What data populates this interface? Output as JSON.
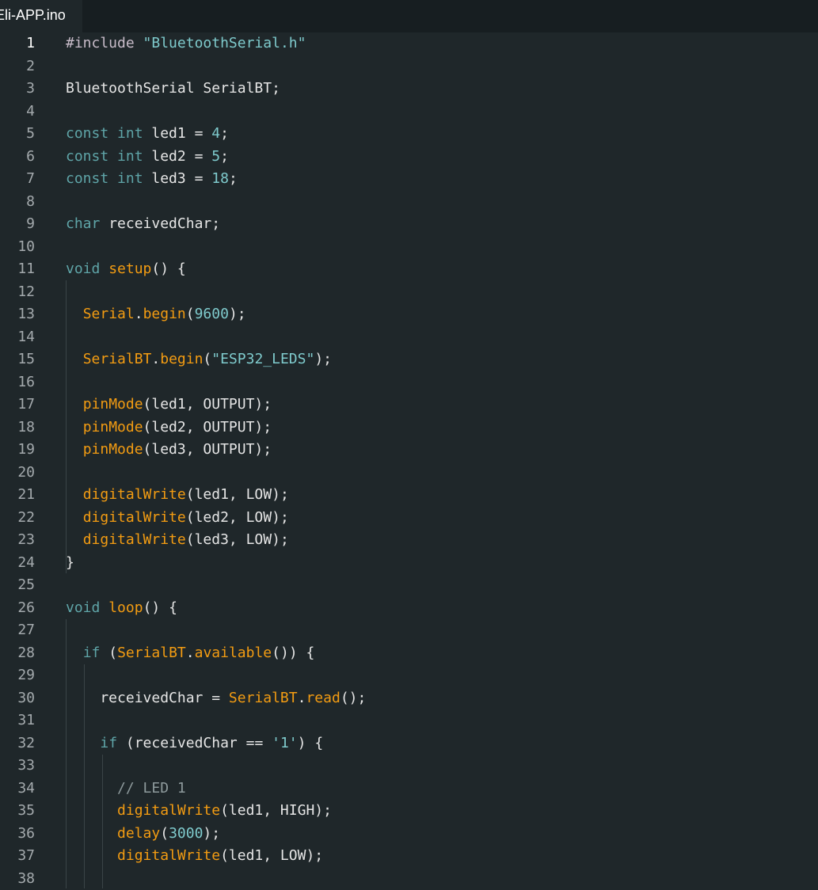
{
  "tab": {
    "label": "Eli-APP.ino"
  },
  "editor": {
    "active_line": 1,
    "lines": [
      {
        "n": "1",
        "tokens": [
          {
            "t": "#include ",
            "c": "pp"
          },
          {
            "t": "\"BluetoothSerial.h\"",
            "c": "str"
          }
        ]
      },
      {
        "n": "2",
        "tokens": []
      },
      {
        "n": "3",
        "tokens": [
          {
            "t": "BluetoothSerial SerialBT;",
            "c": "tx"
          }
        ]
      },
      {
        "n": "4",
        "tokens": []
      },
      {
        "n": "5",
        "tokens": [
          {
            "t": "const",
            "c": "kw"
          },
          {
            "t": " ",
            "c": "tx"
          },
          {
            "t": "int",
            "c": "kw"
          },
          {
            "t": " led1 = ",
            "c": "tx"
          },
          {
            "t": "4",
            "c": "num"
          },
          {
            "t": ";",
            "c": "tx"
          }
        ]
      },
      {
        "n": "6",
        "tokens": [
          {
            "t": "const",
            "c": "kw"
          },
          {
            "t": " ",
            "c": "tx"
          },
          {
            "t": "int",
            "c": "kw"
          },
          {
            "t": " led2 = ",
            "c": "tx"
          },
          {
            "t": "5",
            "c": "num"
          },
          {
            "t": ";",
            "c": "tx"
          }
        ]
      },
      {
        "n": "7",
        "tokens": [
          {
            "t": "const",
            "c": "kw"
          },
          {
            "t": " ",
            "c": "tx"
          },
          {
            "t": "int",
            "c": "kw"
          },
          {
            "t": " led3 = ",
            "c": "tx"
          },
          {
            "t": "18",
            "c": "num"
          },
          {
            "t": ";",
            "c": "tx"
          }
        ]
      },
      {
        "n": "8",
        "tokens": []
      },
      {
        "n": "9",
        "tokens": [
          {
            "t": "char",
            "c": "kw"
          },
          {
            "t": " receivedChar;",
            "c": "tx"
          }
        ]
      },
      {
        "n": "10",
        "tokens": []
      },
      {
        "n": "11",
        "tokens": [
          {
            "t": "void",
            "c": "kw"
          },
          {
            "t": " ",
            "c": "tx"
          },
          {
            "t": "setup",
            "c": "fn"
          },
          {
            "t": "() {",
            "c": "tx"
          }
        ]
      },
      {
        "n": "12",
        "tokens": []
      },
      {
        "n": "13",
        "tokens": [
          {
            "t": "  ",
            "c": "tx"
          },
          {
            "t": "Serial",
            "c": "fn"
          },
          {
            "t": ".",
            "c": "tx"
          },
          {
            "t": "begin",
            "c": "fn"
          },
          {
            "t": "(",
            "c": "tx"
          },
          {
            "t": "9600",
            "c": "num"
          },
          {
            "t": ");",
            "c": "tx"
          }
        ]
      },
      {
        "n": "14",
        "tokens": []
      },
      {
        "n": "15",
        "tokens": [
          {
            "t": "  ",
            "c": "tx"
          },
          {
            "t": "SerialBT",
            "c": "fn"
          },
          {
            "t": ".",
            "c": "tx"
          },
          {
            "t": "begin",
            "c": "fn"
          },
          {
            "t": "(",
            "c": "tx"
          },
          {
            "t": "\"ESP32_LEDS\"",
            "c": "str"
          },
          {
            "t": ");",
            "c": "tx"
          }
        ]
      },
      {
        "n": "16",
        "tokens": []
      },
      {
        "n": "17",
        "tokens": [
          {
            "t": "  ",
            "c": "tx"
          },
          {
            "t": "pinMode",
            "c": "fn"
          },
          {
            "t": "(led1, OUTPUT);",
            "c": "tx"
          }
        ]
      },
      {
        "n": "18",
        "tokens": [
          {
            "t": "  ",
            "c": "tx"
          },
          {
            "t": "pinMode",
            "c": "fn"
          },
          {
            "t": "(led2, OUTPUT);",
            "c": "tx"
          }
        ]
      },
      {
        "n": "19",
        "tokens": [
          {
            "t": "  ",
            "c": "tx"
          },
          {
            "t": "pinMode",
            "c": "fn"
          },
          {
            "t": "(led3, OUTPUT);",
            "c": "tx"
          }
        ]
      },
      {
        "n": "20",
        "tokens": []
      },
      {
        "n": "21",
        "tokens": [
          {
            "t": "  ",
            "c": "tx"
          },
          {
            "t": "digitalWrite",
            "c": "fn"
          },
          {
            "t": "(led1, LOW);",
            "c": "tx"
          }
        ]
      },
      {
        "n": "22",
        "tokens": [
          {
            "t": "  ",
            "c": "tx"
          },
          {
            "t": "digitalWrite",
            "c": "fn"
          },
          {
            "t": "(led2, LOW);",
            "c": "tx"
          }
        ]
      },
      {
        "n": "23",
        "tokens": [
          {
            "t": "  ",
            "c": "tx"
          },
          {
            "t": "digitalWrite",
            "c": "fn"
          },
          {
            "t": "(led3, LOW);",
            "c": "tx"
          }
        ]
      },
      {
        "n": "24",
        "tokens": [
          {
            "t": "}",
            "c": "tx"
          }
        ]
      },
      {
        "n": "25",
        "tokens": []
      },
      {
        "n": "26",
        "tokens": [
          {
            "t": "void",
            "c": "kw"
          },
          {
            "t": " ",
            "c": "tx"
          },
          {
            "t": "loop",
            "c": "fn"
          },
          {
            "t": "() {",
            "c": "tx"
          }
        ]
      },
      {
        "n": "27",
        "tokens": []
      },
      {
        "n": "28",
        "tokens": [
          {
            "t": "  ",
            "c": "tx"
          },
          {
            "t": "if",
            "c": "kw"
          },
          {
            "t": " (",
            "c": "tx"
          },
          {
            "t": "SerialBT",
            "c": "fn"
          },
          {
            "t": ".",
            "c": "tx"
          },
          {
            "t": "available",
            "c": "fn"
          },
          {
            "t": "()) {",
            "c": "tx"
          }
        ]
      },
      {
        "n": "29",
        "tokens": []
      },
      {
        "n": "30",
        "tokens": [
          {
            "t": "    receivedChar = ",
            "c": "tx"
          },
          {
            "t": "SerialBT",
            "c": "fn"
          },
          {
            "t": ".",
            "c": "tx"
          },
          {
            "t": "read",
            "c": "fn"
          },
          {
            "t": "();",
            "c": "tx"
          }
        ]
      },
      {
        "n": "31",
        "tokens": []
      },
      {
        "n": "32",
        "tokens": [
          {
            "t": "    ",
            "c": "tx"
          },
          {
            "t": "if",
            "c": "kw"
          },
          {
            "t": " (receivedChar == ",
            "c": "tx"
          },
          {
            "t": "'1'",
            "c": "str"
          },
          {
            "t": ") {",
            "c": "tx"
          }
        ]
      },
      {
        "n": "33",
        "tokens": []
      },
      {
        "n": "34",
        "tokens": [
          {
            "t": "      ",
            "c": "tx"
          },
          {
            "t": "// LED 1",
            "c": "cm"
          }
        ]
      },
      {
        "n": "35",
        "tokens": [
          {
            "t": "      ",
            "c": "tx"
          },
          {
            "t": "digitalWrite",
            "c": "fn"
          },
          {
            "t": "(led1, HIGH);",
            "c": "tx"
          }
        ]
      },
      {
        "n": "36",
        "tokens": [
          {
            "t": "      ",
            "c": "tx"
          },
          {
            "t": "delay",
            "c": "fn"
          },
          {
            "t": "(",
            "c": "tx"
          },
          {
            "t": "3000",
            "c": "num"
          },
          {
            "t": ");",
            "c": "tx"
          }
        ]
      },
      {
        "n": "37",
        "tokens": [
          {
            "t": "      ",
            "c": "tx"
          },
          {
            "t": "digitalWrite",
            "c": "fn"
          },
          {
            "t": "(led1, LOW);",
            "c": "tx"
          }
        ]
      },
      {
        "n": "38",
        "tokens": []
      }
    ]
  }
}
